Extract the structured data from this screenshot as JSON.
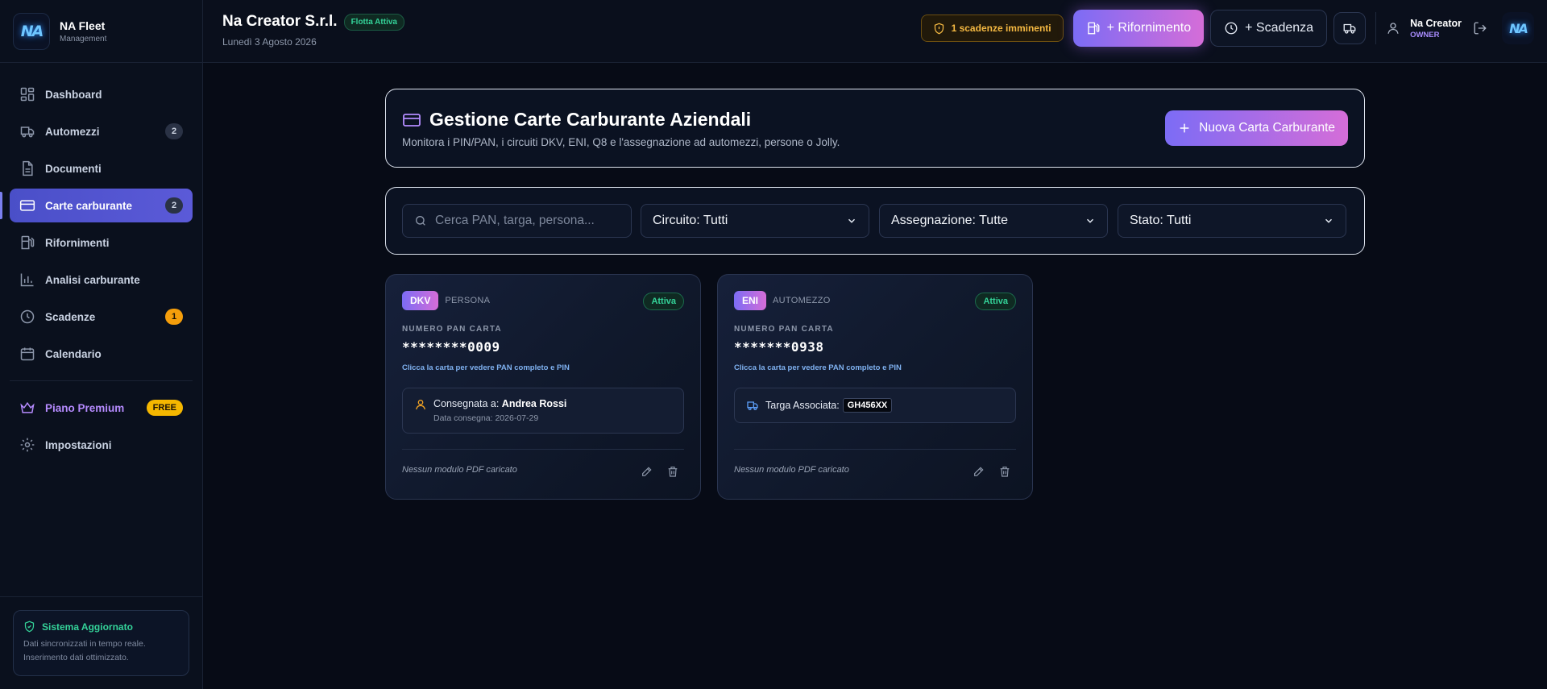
{
  "sidebar": {
    "brand": {
      "logo": "NA",
      "name": "NA Fleet",
      "subtitle": "Management"
    },
    "items": [
      {
        "label": "Dashboard",
        "icon": "dashboard-icon"
      },
      {
        "label": "Automezzi",
        "icon": "truck-icon",
        "badge": "2"
      },
      {
        "label": "Documenti",
        "icon": "document-icon"
      },
      {
        "label": "Carte carburante",
        "icon": "credit-card-icon",
        "badge": "2",
        "active": true
      },
      {
        "label": "Rifornimenti",
        "icon": "fuel-icon"
      },
      {
        "label": "Analisi carburante",
        "icon": "bar-chart-icon"
      },
      {
        "label": "Scadenze",
        "icon": "clock-icon",
        "badge": "1"
      },
      {
        "label": "Calendario",
        "icon": "calendar-icon"
      }
    ],
    "premium": {
      "label": "Piano Premium",
      "badge": "FREE"
    },
    "settings": {
      "label": "Impostazioni"
    },
    "status": {
      "title": "Sistema Aggiornato",
      "line1": "Dati sincronizzati in tempo reale.",
      "line2": "Inserimento dati ottimizzato."
    }
  },
  "header": {
    "company": "Na Creator S.r.l.",
    "fleet_badge": "Flotta Attiva",
    "date": "Lunedì 3 Agosto 2026",
    "alert": "1 scadenze imminenti",
    "refuel_button": "+ Rifornimento",
    "deadline_button": "+ Scadenza",
    "user": {
      "name": "Na Creator",
      "role": "OWNER"
    }
  },
  "page": {
    "title": "Gestione Carte Carburante Aziendali",
    "subtitle": "Monitora i PIN/PAN, i circuiti DKV, ENI, Q8 e l'assegnazione ad automezzi, persone o Jolly.",
    "new_button": "Nuova Carta Carburante"
  },
  "filters": {
    "search_placeholder": "Cerca PAN, targa, persona...",
    "circuit": "Circuito: Tutti",
    "assignment": "Assegnazione: Tutte",
    "status": "Stato: Tutti"
  },
  "cards": [
    {
      "circuit": "DKV",
      "assignment_type": "PERSONA",
      "status": "Attiva",
      "pan_label": "NUMERO PAN CARTA",
      "pan": "********0009",
      "hint": "Clicca la carta per vedere PAN completo e PIN",
      "assigned_label": "Consegnata a:",
      "assigned_name": "Andrea Rossi",
      "assigned_date": "Data consegna: 2026-07-29",
      "pdf": "Nessun modulo PDF caricato"
    },
    {
      "circuit": "ENI",
      "assignment_type": "AUTOMEZZO",
      "status": "Attiva",
      "pan_label": "NUMERO PAN CARTA",
      "pan": "*******0938",
      "hint": "Clicca la carta per vedere PAN completo e PIN",
      "plate_label": "Targa Associata:",
      "plate": "GH456XX",
      "pdf": "Nessun modulo PDF caricato"
    }
  ]
}
